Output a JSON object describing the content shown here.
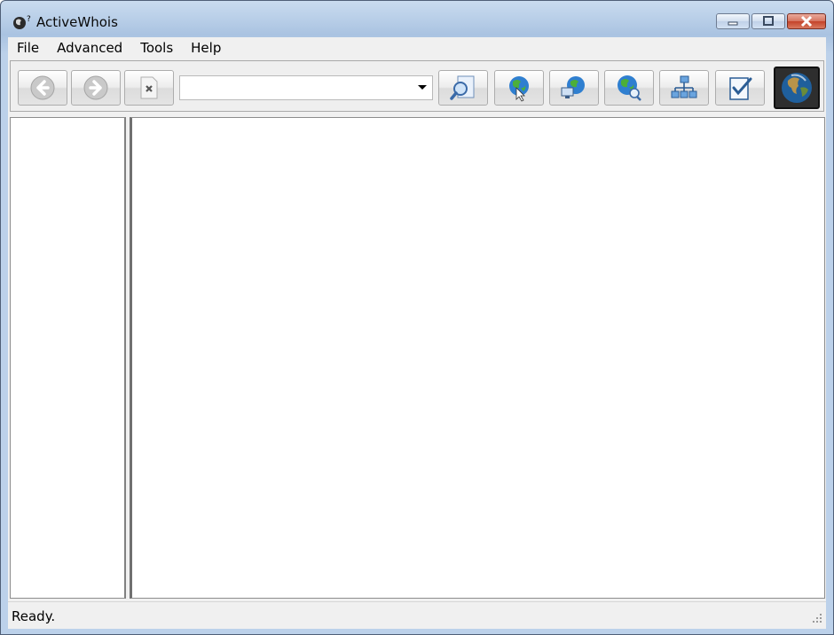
{
  "window": {
    "title": "ActiveWhois",
    "icon": "globe-question-icon"
  },
  "menu": {
    "items": [
      "File",
      "Advanced",
      "Tools",
      "Help"
    ]
  },
  "toolbar": {
    "nav_buttons": [
      {
        "name": "back-button",
        "icon": "back-arrow-icon"
      },
      {
        "name": "forward-button",
        "icon": "forward-arrow-icon"
      },
      {
        "name": "stop-button",
        "icon": "stop-page-icon"
      }
    ],
    "address": {
      "value": ""
    },
    "tool_buttons": [
      {
        "name": "lookup-button",
        "icon": "magnifier-document-icon"
      },
      {
        "name": "web-button",
        "icon": "globe-cursor-icon"
      },
      {
        "name": "network-button",
        "icon": "globe-computers-icon"
      },
      {
        "name": "globe-search-button",
        "icon": "globe-magnifier-icon"
      },
      {
        "name": "network-tree-button",
        "icon": "network-tree-icon"
      },
      {
        "name": "report-button",
        "icon": "checklist-icon"
      }
    ],
    "logo": {
      "icon": "earth-logo-icon"
    }
  },
  "status": {
    "text": "Ready."
  }
}
